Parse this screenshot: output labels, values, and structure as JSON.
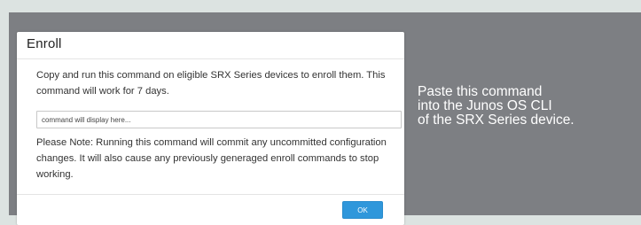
{
  "dialog": {
    "title": "Enroll",
    "description": "Copy and run this command on eligible SRX Series devices to enroll them. This command will work for 7 days.",
    "command_field": {
      "value": "",
      "placeholder": "command will display here..."
    },
    "note": "Please Note: Running this command will commit any uncommitted configuration changes. It will also cause any previously generaged enroll commands to stop working.",
    "ok_label": "OK"
  },
  "callout": {
    "line1": "Paste this command",
    "line2": "into the Junos OS CLI",
    "line3": "of the SRX Series device."
  },
  "colors": {
    "page_background": "#dce3e1",
    "frame_background": "#7d7f83",
    "dialog_background": "#ffffff",
    "primary_button": "#2f97db",
    "callout_text": "#ffffff"
  }
}
